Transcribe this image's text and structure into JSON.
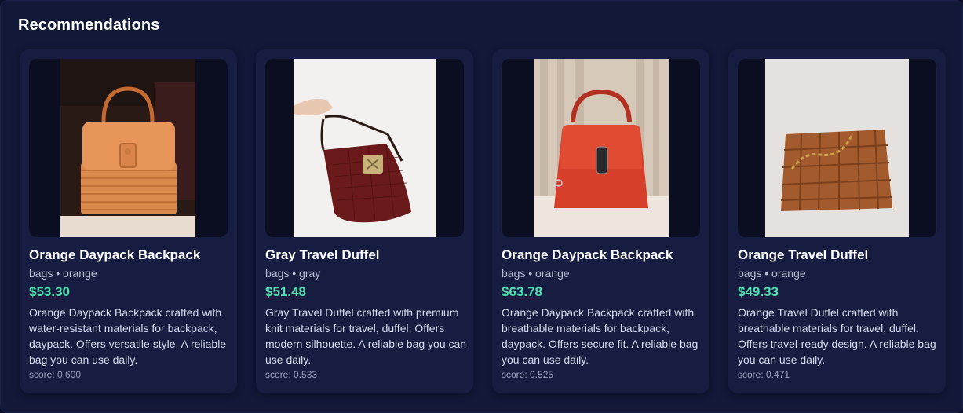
{
  "section": {
    "title": "Recommendations"
  },
  "products": [
    {
      "name": "Orange Daypack Backpack",
      "category": "bags",
      "color": "orange",
      "price": "$53.30",
      "description": "Orange Daypack Backpack crafted with water-resistant materials for backpack, daypack. Offers versatile style. A reliable bag you can use daily.",
      "score": "score: 0.600",
      "image_subject": "orange-woven-handbag"
    },
    {
      "name": "Gray Travel Duffel",
      "category": "bags",
      "color": "gray",
      "price": "$51.48",
      "description": "Gray Travel Duffel crafted with premium knit materials for travel, duffel. Offers modern silhouette. A reliable bag you can use daily.",
      "score": "score: 0.533",
      "image_subject": "brown-croc-shoulder-bag"
    },
    {
      "name": "Orange Daypack Backpack",
      "category": "bags",
      "color": "orange",
      "price": "$63.78",
      "description": "Orange Daypack Backpack crafted with breathable materials for backpack, daypack. Offers secure fit. A reliable bag you can use daily.",
      "score": "score: 0.525",
      "image_subject": "red-top-handle-bag"
    },
    {
      "name": "Orange Travel Duffel",
      "category": "bags",
      "color": "orange",
      "price": "$49.33",
      "description": "Orange Travel Duffel crafted with breathable materials for travel, duffel. Offers travel-ready design. A reliable bag you can use daily.",
      "score": "score: 0.471",
      "image_subject": "tan-woven-chain-bag"
    }
  ],
  "meta_separator": "•",
  "colors": {
    "background": "#0b1028",
    "card": "#161d40",
    "price": "#4fe0b0",
    "title": "#ffffff"
  }
}
